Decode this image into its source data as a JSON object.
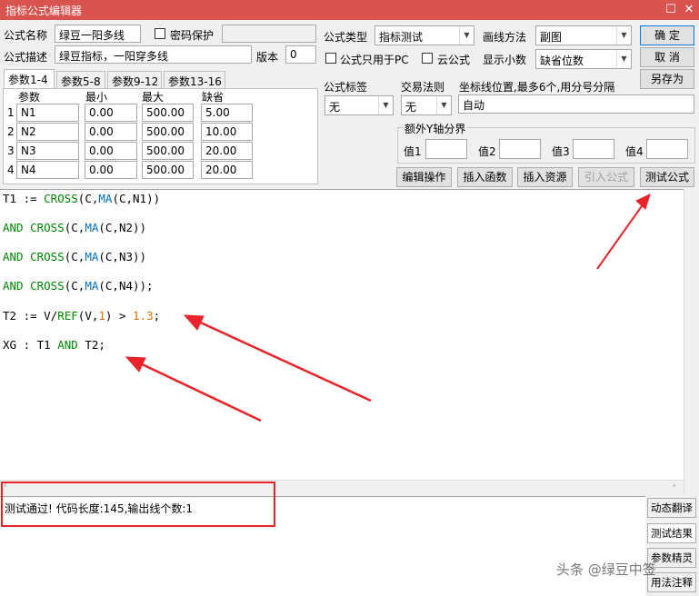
{
  "window": {
    "title": "指标公式编辑器",
    "maximize_icon": "maximize-icon",
    "close_icon": "close-icon"
  },
  "form": {
    "name_label": "公式名称",
    "name_value": "绿豆一阳多线",
    "password_label": "密码保护",
    "desc_label": "公式描述",
    "desc_value": "绿豆指标，一阳穿多线",
    "version_label": "版本",
    "version_value": "0",
    "type_label": "公式类型",
    "type_value": "指标测试",
    "draw_label": "画线方法",
    "draw_value": "副图",
    "pc_only_label": "公式只用于PC",
    "cloud_label": "云公式",
    "decimal_label": "显示小数",
    "decimal_value": "缺省位数",
    "tag_label": "公式标签",
    "tag_value": "无",
    "trade_label": "交易法则",
    "trade_value": "无",
    "coord_label": "坐标线位置,最多6个,用分号分隔",
    "coord_value": "自动",
    "yaxis_label": "额外Y轴分界",
    "y_values": [
      "值1",
      "值2",
      "值3",
      "值4"
    ]
  },
  "buttons": {
    "ok": "确  定",
    "cancel": "取  消",
    "save_as": "另存为",
    "edit_ops": "编辑操作",
    "insert_func": "插入函数",
    "insert_res": "插入资源",
    "import_formula": "引入公式",
    "test_formula": "测试公式"
  },
  "tabs": [
    "参数1-4",
    "参数5-8",
    "参数9-12",
    "参数13-16"
  ],
  "params": {
    "headers": [
      "参数",
      "最小",
      "最大",
      "缺省"
    ],
    "rows": [
      {
        "num": "1",
        "name": "N1",
        "min": "0.00",
        "max": "500.00",
        "def": "5.00"
      },
      {
        "num": "2",
        "name": "N2",
        "min": "0.00",
        "max": "500.00",
        "def": "10.00"
      },
      {
        "num": "3",
        "name": "N3",
        "min": "0.00",
        "max": "500.00",
        "def": "20.00"
      },
      {
        "num": "4",
        "name": "N4",
        "min": "0.00",
        "max": "500.00",
        "def": "20.00"
      }
    ]
  },
  "code": {
    "line1": [
      {
        "t": "T1 := ",
        "c": ""
      },
      {
        "t": "CROSS",
        "c": "kw"
      },
      {
        "t": "(C,",
        "c": ""
      },
      {
        "t": "MA",
        "c": "fn"
      },
      {
        "t": "(C,N1))",
        "c": ""
      }
    ],
    "line2": [
      {
        "t": "AND CROSS",
        "c": "kw"
      },
      {
        "t": "(C,",
        "c": ""
      },
      {
        "t": "MA",
        "c": "fn"
      },
      {
        "t": "(C,N2))",
        "c": ""
      }
    ],
    "line3": [
      {
        "t": "AND CROSS",
        "c": "kw"
      },
      {
        "t": "(C,",
        "c": ""
      },
      {
        "t": "MA",
        "c": "fn"
      },
      {
        "t": "(C,N3))",
        "c": ""
      }
    ],
    "line4": [
      {
        "t": "AND CROSS",
        "c": "kw"
      },
      {
        "t": "(C,",
        "c": ""
      },
      {
        "t": "MA",
        "c": "fn"
      },
      {
        "t": "(C,N4));",
        "c": ""
      }
    ],
    "line5": [
      {
        "t": "T2 := V/",
        "c": ""
      },
      {
        "t": "REF",
        "c": "kw"
      },
      {
        "t": "(V,",
        "c": ""
      },
      {
        "t": "1",
        "c": "num"
      },
      {
        "t": ") > ",
        "c": ""
      },
      {
        "t": "1.3",
        "c": "num"
      },
      {
        "t": ";",
        "c": ""
      }
    ],
    "line6": [
      {
        "t": "XG : T1 ",
        "c": ""
      },
      {
        "t": "AND",
        "c": "kw"
      },
      {
        "t": " T2;",
        "c": ""
      }
    ]
  },
  "output": {
    "message": "测试通过! 代码长度:145,输出线个数:1"
  },
  "side_tabs": [
    "动态翻译",
    "测试结果",
    "参数精灵",
    "用法注释"
  ],
  "watermark": "头条 @绿豆中签"
}
